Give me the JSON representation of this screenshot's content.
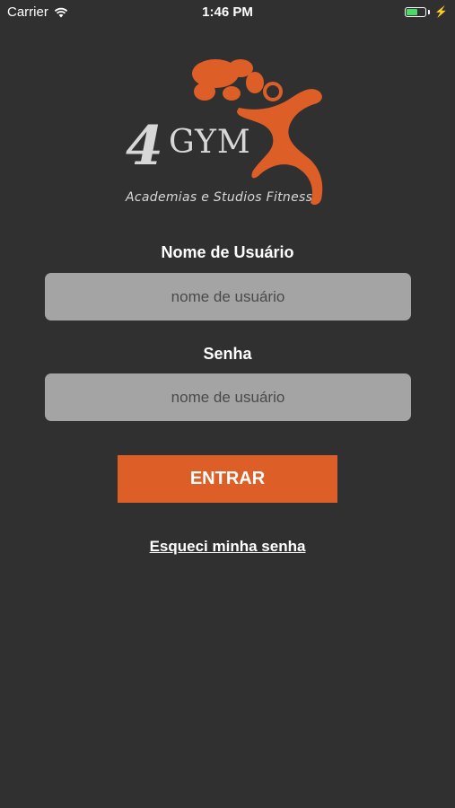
{
  "status_bar": {
    "carrier": "Carrier",
    "time": "1:46 PM",
    "battery_level": 0.65,
    "battery_color": "#4cd964"
  },
  "logo": {
    "brand_number": "4",
    "brand_name": "GYM",
    "tagline": "Academias e Studios Fitness",
    "accent_color": "#dd5e26"
  },
  "form": {
    "username_label": "Nome de Usuário",
    "username_placeholder": "nome de usuário",
    "password_label": "Senha",
    "password_placeholder": "nome de usuário",
    "submit_label": "ENTRAR",
    "forgot_label": "Esqueci minha senha"
  },
  "colors": {
    "background": "#303030",
    "input_background": "#a4a4a4",
    "button": "#dd5e26"
  }
}
